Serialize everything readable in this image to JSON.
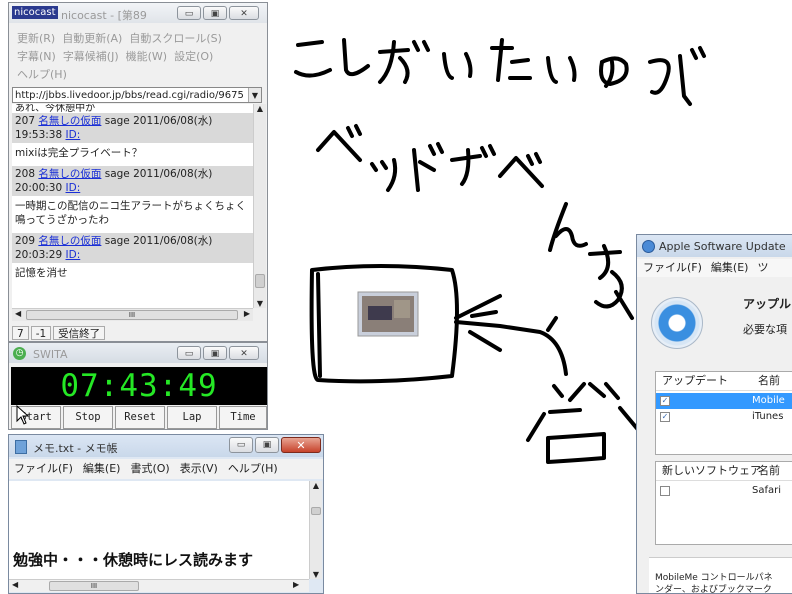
{
  "nicocast": {
    "logo": "nicocast",
    "title": "nicocast - [第89",
    "menu_row1": [
      "更新(R)",
      "自動更新(A)",
      "自動スクロール(S)"
    ],
    "menu_row2": [
      "字幕(N)",
      "字幕候補(J)",
      "機能(W)",
      "設定(O)"
    ],
    "menu_row3": [
      "ヘルプ(H)"
    ],
    "url": "http://jbbs.livedoor.jp/bbs/read.cgi/radio/9675",
    "partial_line": "あれ、今休憩中か",
    "posts": [
      {
        "num": "207",
        "name": "名無しの仮面",
        "mail": "sage",
        "date": "2011/06/08(水)",
        "time": "19:53:38",
        "id": "ID:",
        "body": [
          "mixiは完全プライベート？"
        ]
      },
      {
        "num": "208",
        "name": "名無しの仮面",
        "mail": "sage",
        "date": "2011/06/08(水)",
        "time": "20:00:30",
        "id": "ID:",
        "body": [
          "一時期この配信のニコ生アラートがちょくちょく",
          "鳴ってうざかったわ"
        ]
      },
      {
        "num": "209",
        "name": "名無しの仮面",
        "mail": "sage",
        "date": "2011/06/08(水)",
        "time": "20:03:29",
        "id": "ID:",
        "body": [
          "記憶を消せ"
        ]
      }
    ],
    "scroll_mid": "III",
    "status": [
      "7",
      "-1",
      "受信終了"
    ]
  },
  "swita": {
    "title": "SWITA",
    "time": "07:43:49",
    "buttons": [
      "Start",
      "Stop",
      "Reset",
      "Lap",
      "Time"
    ]
  },
  "notepad": {
    "title": "メモ.txt - メモ帳",
    "menu": [
      "ファイル(F)",
      "編集(E)",
      "書式(O)",
      "表示(V)",
      "ヘルプ(H)"
    ],
    "text": "勉強中・・・休憩時にレス読みます",
    "scroll_mid": "III"
  },
  "apple_update": {
    "title": "Apple Software Update",
    "menu": [
      "ファイル(F)",
      "編集(E)",
      "ツ"
    ],
    "heading": "アップル",
    "subtext": "必要な項",
    "updates_header": [
      "アップデート",
      "名前"
    ],
    "updates": [
      {
        "name": "Mobile",
        "checked": true,
        "selected": true
      },
      {
        "name": "iTunes",
        "checked": true,
        "selected": false
      }
    ],
    "new_header": [
      "新しいソフトウェア",
      "名前"
    ],
    "new_items": [
      {
        "name": "Safari",
        "checked": false
      }
    ],
    "footer": [
      "MobileMe コントロールパネ",
      "ンダー、およびブックマーク"
    ]
  },
  "drawing": {
    "handwriting_line1": "こしがいたいので",
    "handwriting_line2": "ベッドでべんきょう",
    "handwriting_char": "谷"
  },
  "icons": [
    "minimize-icon",
    "maximize-icon",
    "close-icon",
    "dropdown-arrow-icon",
    "scroll-up-icon",
    "scroll-down-icon",
    "scroll-left-icon",
    "scroll-right-icon",
    "mouse-cursor-icon",
    "update-globe-icon",
    "checkbox-icon"
  ],
  "colors": {
    "clock_bg": "#000000",
    "clock_digits": "#25e825",
    "link": "#1a2fd6",
    "selection": "#3399ff",
    "close_button": "#c7432b"
  }
}
